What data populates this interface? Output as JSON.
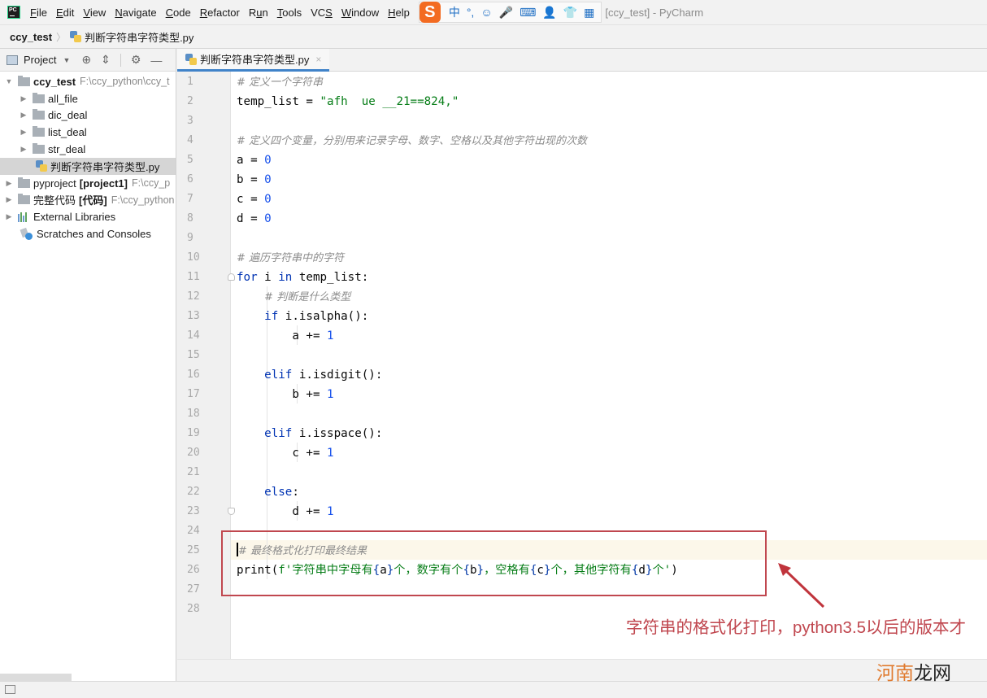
{
  "menubar": {
    "app_icon": "pycharm-logo",
    "app_icon_text": "PC",
    "items": [
      {
        "label": "File",
        "mnemonic": "F"
      },
      {
        "label": "Edit",
        "mnemonic": "E"
      },
      {
        "label": "View",
        "mnemonic": "V"
      },
      {
        "label": "Navigate",
        "mnemonic": "N"
      },
      {
        "label": "Code",
        "mnemonic": "C"
      },
      {
        "label": "Refactor",
        "mnemonic": "R"
      },
      {
        "label": "Run",
        "mnemonic": "u"
      },
      {
        "label": "Tools",
        "mnemonic": "T"
      },
      {
        "label": "VCS",
        "mnemonic": "S"
      },
      {
        "label": "Window",
        "mnemonic": "W"
      },
      {
        "label": "Help",
        "mnemonic": "H"
      }
    ],
    "ime": {
      "logo": "S",
      "items": [
        "中",
        "°,",
        "☺",
        "🎤",
        "⌨",
        "👤",
        "👕",
        "▦"
      ]
    },
    "window_title": "[ccy_test] - PyCharm"
  },
  "breadcrumb": {
    "root": "ccy_test",
    "separator": "〉",
    "file": "判断字符串字符类型.py"
  },
  "project_panel": {
    "title": "Project",
    "dropdown_icon": "▼",
    "toolbar_icons": [
      "locate-icon",
      "collapse-icon",
      "gear-icon",
      "hide-icon"
    ],
    "toolbar_glyphs": [
      "⊕",
      "⇕",
      "⚙",
      "—"
    ],
    "tree": [
      {
        "type": "root-folder",
        "expanded": true,
        "label": "ccy_test",
        "path": "F:\\ccy_python\\ccy_t",
        "depth": 0
      },
      {
        "type": "folder",
        "expanded": false,
        "label": "all_file",
        "depth": 1
      },
      {
        "type": "folder",
        "expanded": false,
        "label": "dic_deal",
        "depth": 1
      },
      {
        "type": "folder",
        "expanded": false,
        "label": "list_deal",
        "depth": 1
      },
      {
        "type": "folder",
        "expanded": false,
        "label": "str_deal",
        "depth": 1
      },
      {
        "type": "file",
        "label": "判断字符串字符类型.py",
        "selected": true,
        "depth": 1
      },
      {
        "type": "root-folder",
        "expanded": false,
        "label": "pyproject",
        "badge": "[project1]",
        "path": "F:\\ccy_p",
        "depth": 0
      },
      {
        "type": "root-folder",
        "expanded": false,
        "label": "完整代码",
        "badge": "[代码]",
        "path": "F:\\ccy_python",
        "depth": 0
      },
      {
        "type": "libraries",
        "expanded": false,
        "label": "External Libraries",
        "depth": 0
      },
      {
        "type": "scratches",
        "label": "Scratches and Consoles",
        "depth": 0
      }
    ]
  },
  "editor": {
    "tabs": [
      {
        "label": "判断字符串字符类型.py",
        "active": true,
        "close_icon": "×"
      }
    ],
    "caret_line": 25,
    "lines": [
      {
        "n": "1",
        "tokens": [
          {
            "t": "cmt",
            "v": "# 定义一个字符串"
          }
        ]
      },
      {
        "n": "2",
        "tokens": [
          {
            "t": "id",
            "v": "temp_list = "
          },
          {
            "t": "str",
            "v": "\"afh  ue __21==824,\""
          }
        ]
      },
      {
        "n": "3",
        "tokens": []
      },
      {
        "n": "4",
        "tokens": [
          {
            "t": "cmt",
            "v": "# 定义四个变量，分别用来记录字母、数字、空格以及其他字符出现的次数"
          }
        ]
      },
      {
        "n": "5",
        "tokens": [
          {
            "t": "id",
            "v": "a = "
          },
          {
            "t": "num",
            "v": "0"
          }
        ]
      },
      {
        "n": "6",
        "tokens": [
          {
            "t": "id",
            "v": "b = "
          },
          {
            "t": "num",
            "v": "0"
          }
        ]
      },
      {
        "n": "7",
        "tokens": [
          {
            "t": "id",
            "v": "c = "
          },
          {
            "t": "num",
            "v": "0"
          }
        ]
      },
      {
        "n": "8",
        "tokens": [
          {
            "t": "id",
            "v": "d = "
          },
          {
            "t": "num",
            "v": "0"
          }
        ]
      },
      {
        "n": "9",
        "tokens": []
      },
      {
        "n": "10",
        "tokens": [
          {
            "t": "cmt",
            "v": "# 遍历字符串中的字符"
          }
        ]
      },
      {
        "n": "11",
        "tokens": [
          {
            "t": "kw",
            "v": "for"
          },
          {
            "t": "id",
            "v": " i "
          },
          {
            "t": "kw",
            "v": "in"
          },
          {
            "t": "id",
            "v": " temp_list:"
          }
        ]
      },
      {
        "n": "12",
        "tokens": [
          {
            "t": "id",
            "v": "    "
          },
          {
            "t": "cmt",
            "v": "# 判断是什么类型"
          }
        ]
      },
      {
        "n": "13",
        "tokens": [
          {
            "t": "id",
            "v": "    "
          },
          {
            "t": "kw",
            "v": "if"
          },
          {
            "t": "id",
            "v": " i.isalpha():"
          }
        ]
      },
      {
        "n": "14",
        "tokens": [
          {
            "t": "id",
            "v": "        a += "
          },
          {
            "t": "num",
            "v": "1"
          }
        ]
      },
      {
        "n": "15",
        "tokens": []
      },
      {
        "n": "16",
        "tokens": [
          {
            "t": "id",
            "v": "    "
          },
          {
            "t": "kw",
            "v": "elif"
          },
          {
            "t": "id",
            "v": " i.isdigit():"
          }
        ]
      },
      {
        "n": "17",
        "tokens": [
          {
            "t": "id",
            "v": "        b += "
          },
          {
            "t": "num",
            "v": "1"
          }
        ]
      },
      {
        "n": "18",
        "tokens": []
      },
      {
        "n": "19",
        "tokens": [
          {
            "t": "id",
            "v": "    "
          },
          {
            "t": "kw",
            "v": "elif"
          },
          {
            "t": "id",
            "v": " i.isspace():"
          }
        ]
      },
      {
        "n": "20",
        "tokens": [
          {
            "t": "id",
            "v": "        c += "
          },
          {
            "t": "num",
            "v": "1"
          }
        ]
      },
      {
        "n": "21",
        "tokens": []
      },
      {
        "n": "22",
        "tokens": [
          {
            "t": "id",
            "v": "    "
          },
          {
            "t": "kw",
            "v": "else"
          },
          {
            "t": "id",
            "v": ":"
          }
        ]
      },
      {
        "n": "23",
        "tokens": [
          {
            "t": "id",
            "v": "        d += "
          },
          {
            "t": "num",
            "v": "1"
          }
        ]
      },
      {
        "n": "24",
        "tokens": []
      },
      {
        "n": "25",
        "tokens": [
          {
            "t": "caret",
            "v": ""
          },
          {
            "t": "cmt",
            "v": "# 最终格式化打印最终结果"
          }
        ]
      },
      {
        "n": "26",
        "tokens": [
          {
            "t": "id",
            "v": "print("
          },
          {
            "t": "str",
            "v": "f'字符串中字母有"
          },
          {
            "t": "brace",
            "v": "{"
          },
          {
            "t": "id",
            "v": "a"
          },
          {
            "t": "brace",
            "v": "}"
          },
          {
            "t": "str",
            "v": "个，数字有个"
          },
          {
            "t": "brace",
            "v": "{"
          },
          {
            "t": "id",
            "v": "b"
          },
          {
            "t": "brace",
            "v": "}"
          },
          {
            "t": "str",
            "v": "，空格有"
          },
          {
            "t": "brace",
            "v": "{"
          },
          {
            "t": "id",
            "v": "c"
          },
          {
            "t": "brace",
            "v": "}"
          },
          {
            "t": "str",
            "v": "个，其他字符有"
          },
          {
            "t": "brace",
            "v": "{"
          },
          {
            "t": "id",
            "v": "d"
          },
          {
            "t": "brace",
            "v": "}"
          },
          {
            "t": "str",
            "v": "个'"
          },
          {
            "t": "id",
            "v": ")"
          }
        ]
      },
      {
        "n": "27",
        "tokens": []
      },
      {
        "n": "28",
        "tokens": []
      }
    ]
  },
  "annotation": {
    "text": "字符串的格式化打印，python3.5以后的版本才",
    "color": "#c0474f"
  },
  "watermark": {
    "part_a": "河南",
    "part_b": "龙网"
  },
  "colors": {
    "keyword": "#0033b3",
    "string": "#067d17",
    "number": "#1750eb",
    "comment": "#8c8c8c",
    "tab_underline": "#4083c9",
    "annotation": "#c0474f"
  }
}
